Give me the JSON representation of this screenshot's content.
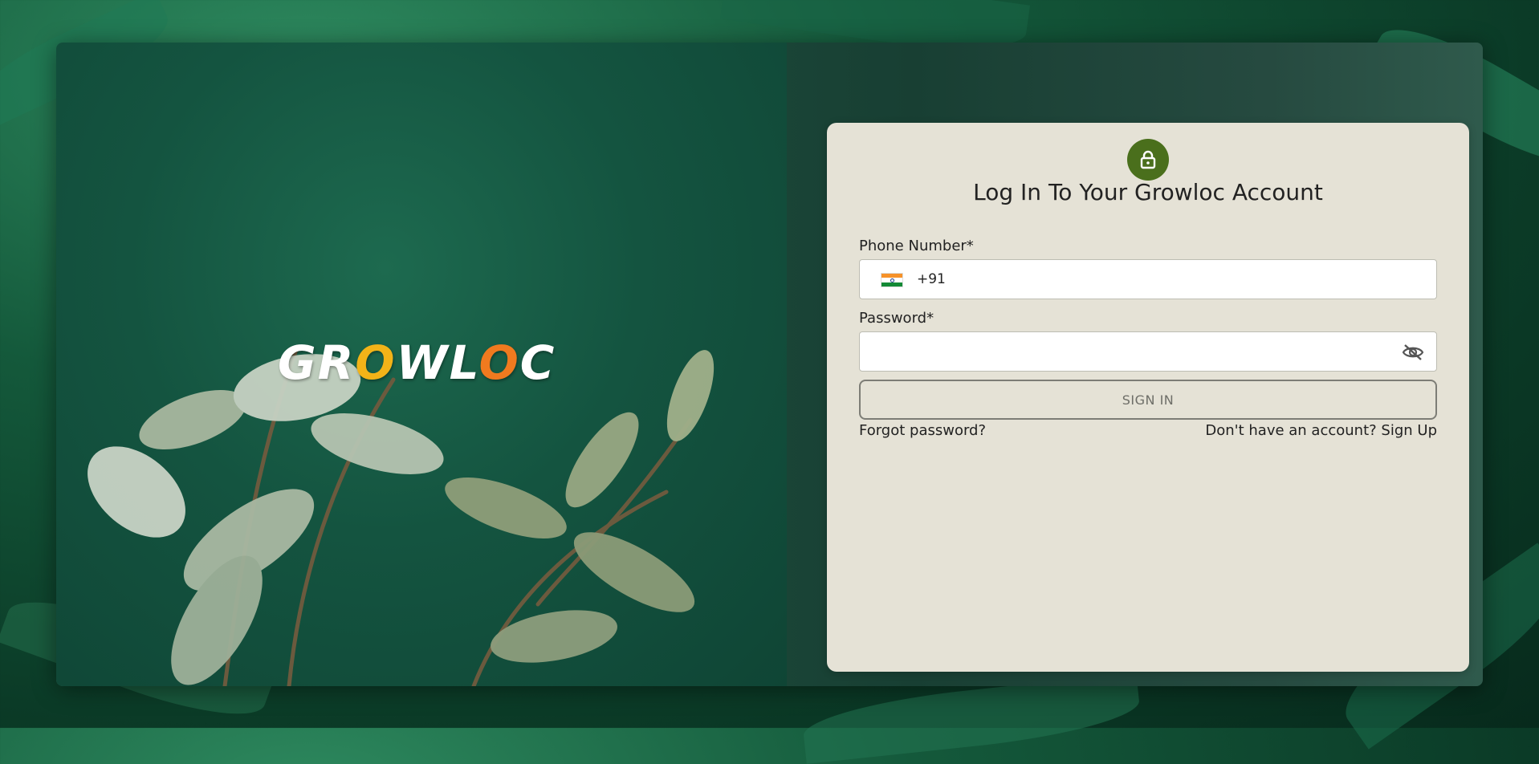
{
  "brand": {
    "logo_part1": "GR",
    "logo_part2": "O",
    "logo_part3": "WL",
    "logo_part4": "O",
    "logo_part5": "C",
    "accent_yellow": "#f2b318",
    "accent_orange": "#f07a1f"
  },
  "login": {
    "title": "Log In To Your Growloc Account",
    "lock_icon": "lock-icon",
    "badge_color": "#4a6f1c",
    "phone": {
      "label": "Phone Number*",
      "country_flag": "india-flag-icon",
      "dial_code": "+91",
      "value": ""
    },
    "password": {
      "label": "Password*",
      "value": "",
      "visibility_icon": "eye-off-icon"
    },
    "submit_label": "SIGN IN",
    "forgot_label": "Forgot password?",
    "signup_label": "Don't have an account? Sign Up"
  },
  "colors": {
    "card_background": "#e5e2d6"
  }
}
